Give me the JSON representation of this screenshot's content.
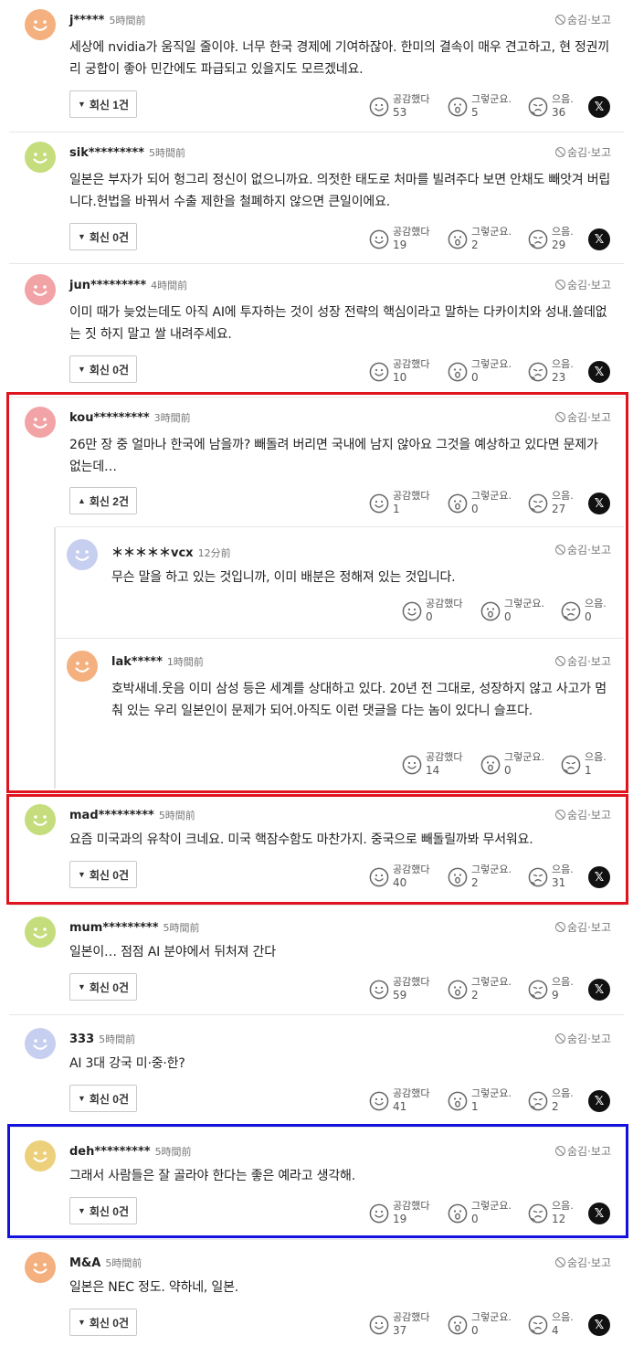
{
  "ui": {
    "hide_report": "숨김·보고",
    "reaction_labels": {
      "like": "공감했다",
      "wow": "그렇군요.",
      "sad": "으음."
    },
    "x_label": "𝕏"
  },
  "colors": {
    "avatar_orange": "#f4b07e",
    "avatar_green": "#c5dd7c",
    "avatar_pink": "#f2a3a6",
    "avatar_blue": "#c7cff0",
    "avatar_yellow": "#ecd07c",
    "highlight_red": "#e0141e",
    "highlight_blue": "#1410e0"
  },
  "comments": [
    {
      "author": "j*****",
      "time": "5時間前",
      "text": "세상에 nvidia가 움직일 줄이야. 너무 한국 경제에 기여하잖아. 한미의 결속이 매우 견고하고, 현 정권끼리 궁합이 좋아 민간에도 파급되고 있을지도 모르겠네요.",
      "replies": "회신 1건",
      "like": "53",
      "wow": "5",
      "sad": "36"
    },
    {
      "author": "sik*********",
      "time": "5時間前",
      "text": "일본은 부자가 되어 헝그리 정신이 없으니까요. 의젓한 태도로 처마를 빌려주다 보면 안채도 빼앗겨 버립니다.헌법을 바꿔서 수출 제한을 철폐하지 않으면 큰일이에요.",
      "replies": "회신 0건",
      "like": "19",
      "wow": "2",
      "sad": "29"
    },
    {
      "author": "jun*********",
      "time": "4時間前",
      "text": "이미 때가 늦었는데도 아직 AI에 투자하는 것이 성장 전략의 핵심이라고 말하는 다카이치와 성내.쓸데없는 짓 하지 말고 쌀 내려주세요.",
      "replies": "회신 0건",
      "like": "10",
      "wow": "0",
      "sad": "23"
    },
    {
      "author": "kou*********",
      "time": "3時間前",
      "text": "26만 장 중 얼마나 한국에 남을까? 빼돌려 버리면 국내에 남지 않아요 그것을 예상하고 있다면 문제가 없는데…",
      "replies": "회신 2건",
      "like": "1",
      "wow": "0",
      "sad": "27"
    },
    {
      "author": "＊＊＊＊＊vcx",
      "time": "12分前",
      "text": "무슨 말을 하고 있는 것입니까, 이미 배분은 정해져 있는 것입니다.",
      "like": "0",
      "wow": "0",
      "sad": "0"
    },
    {
      "author": "lak*****",
      "time": "1時間前",
      "text": "호박새네.웃음 이미 삼성 등은 세계를 상대하고 있다. 20년 전 그대로, 성장하지 않고 사고가 멈춰 있는 우리 일본인이 문제가 되어.아직도 이런 댓글을 다는 놈이 있다니 슬프다.",
      "like": "14",
      "wow": "0",
      "sad": "1"
    },
    {
      "author": "mad*********",
      "time": "5時間前",
      "text": "요즘 미국과의 유착이 크네요. 미국 핵잠수함도 마찬가지. 중국으로 빼돌릴까봐 무서워요.",
      "replies": "회신 0건",
      "like": "40",
      "wow": "2",
      "sad": "31"
    },
    {
      "author": "mum*********",
      "time": "5時間前",
      "text": "일본이… 점점 AI 분야에서 뒤처져 간다",
      "replies": "회신 0건",
      "like": "59",
      "wow": "2",
      "sad": "9"
    },
    {
      "author": "333",
      "time": "5時間前",
      "text": "AI 3대 강국 미·중·한?",
      "replies": "회신 0건",
      "like": "41",
      "wow": "1",
      "sad": "2"
    },
    {
      "author": "deh*********",
      "time": "5時間前",
      "text": "그래서 사람들은 잘 골라야 한다는 좋은 예라고 생각해.",
      "replies": "회신 0건",
      "like": "19",
      "wow": "0",
      "sad": "12"
    },
    {
      "author": "M&A",
      "time": "5時間前",
      "text": "일본은 NEC 정도. 약하네, 일본.",
      "replies": "회신 0건",
      "like": "37",
      "wow": "0",
      "sad": "4"
    }
  ]
}
